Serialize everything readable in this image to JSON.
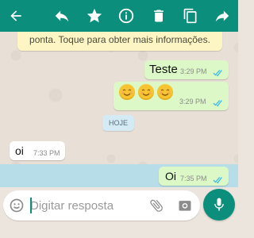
{
  "toolbar": {
    "icons": [
      "back-arrow-icon",
      "reply-icon",
      "star-icon",
      "info-icon",
      "delete-icon",
      "copy-icon",
      "forward-icon"
    ],
    "background": "#0b8f7c"
  },
  "system_note": {
    "text": "ponta. Toque para obter mais informações."
  },
  "messages": [
    {
      "direction": "out",
      "text": "Teste",
      "time": "3:29 PM",
      "status": "read"
    },
    {
      "direction": "out",
      "text": "☺☺☺",
      "time": "3:29 PM",
      "status": "read",
      "emoji_count": 3
    },
    {
      "direction": "in",
      "text": "oi",
      "time": "7:33 PM"
    },
    {
      "direction": "out",
      "text": "Oi",
      "time": "7:35 PM",
      "status": "read",
      "selected": true
    }
  ],
  "date_divider": {
    "label": "HOJE"
  },
  "composer": {
    "placeholder": "Digitar resposta",
    "value": ""
  },
  "colors": {
    "accent": "#0b8f7c",
    "outgoing_bubble": "#dcf8c6",
    "incoming_bubble": "#ffffff",
    "read_ticks": "#34b7f1",
    "selection": "#b7dde9"
  }
}
